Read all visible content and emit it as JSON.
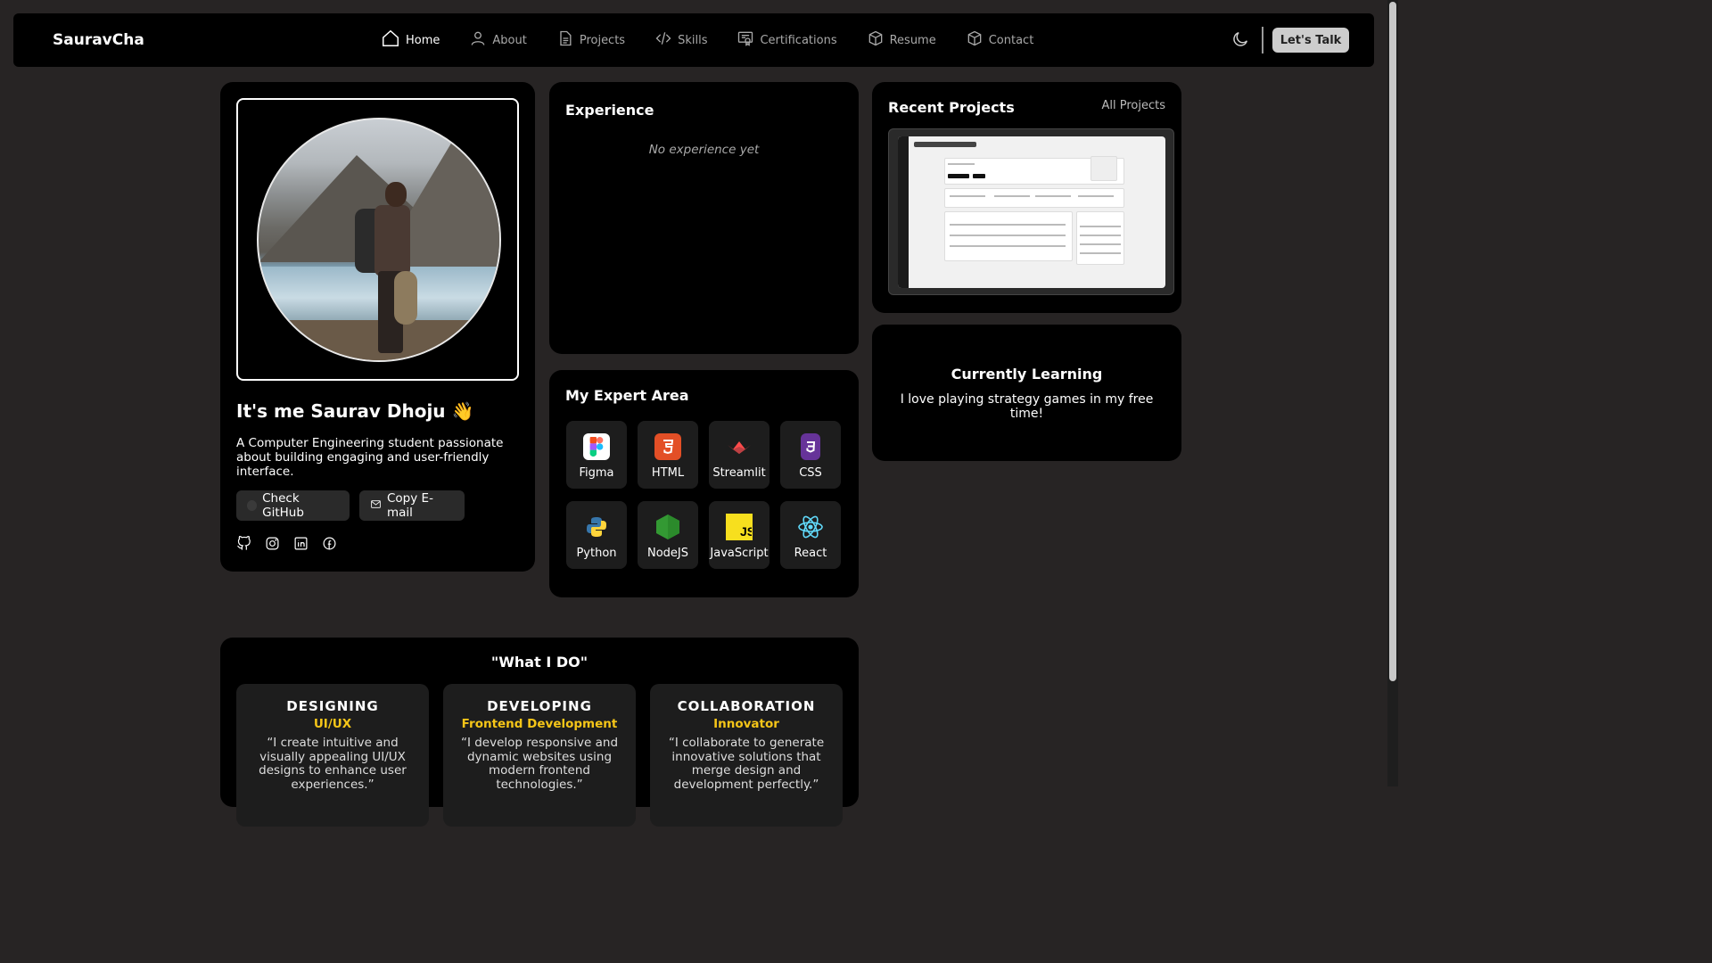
{
  "navbar": {
    "brand": "SauravCha",
    "items": [
      {
        "label": "Home",
        "icon": "home-icon",
        "active": true
      },
      {
        "label": "About",
        "icon": "user-icon"
      },
      {
        "label": "Projects",
        "icon": "file-icon"
      },
      {
        "label": "Skills",
        "icon": "code-icon"
      },
      {
        "label": "Certifications",
        "icon": "certificate-icon"
      },
      {
        "label": "Resume",
        "icon": "box-icon"
      },
      {
        "label": "Contact",
        "icon": "box-icon"
      }
    ],
    "theme_icon": "moon-icon",
    "cta_label": "Let's Talk"
  },
  "profile": {
    "greeting": "It's me Saurav Dhoju 👋",
    "bio": "A Computer Engineering student passionate about building engaging and user-friendly interface.",
    "github_label": "Check GitHub",
    "email_label": "Copy E-mail",
    "socials": [
      "github-icon",
      "instagram-icon",
      "linkedin-icon",
      "facebook-icon"
    ]
  },
  "experience": {
    "title": "Experience",
    "empty_text": "No experience yet"
  },
  "expert": {
    "title": "My Expert Area",
    "skills": [
      {
        "label": "Figma",
        "icon": "figma-icon",
        "color": "#ffffff"
      },
      {
        "label": "HTML",
        "icon": "html5-icon",
        "color": "#e34f26"
      },
      {
        "label": "Streamlit",
        "icon": "streamlit-icon",
        "color": "#ff4b4b"
      },
      {
        "label": "CSS",
        "icon": "css3-icon",
        "color": "#663399"
      },
      {
        "label": "Python",
        "icon": "python-icon",
        "color": "#3776ab"
      },
      {
        "label": "NodeJS",
        "icon": "nodejs-icon",
        "color": "#339933"
      },
      {
        "label": "JavaScript",
        "icon": "javascript-icon",
        "color": "#f7df1e"
      },
      {
        "label": "React",
        "icon": "react-icon",
        "color": "#61dafb"
      }
    ]
  },
  "projects": {
    "title": "Recent Projects",
    "all_label": "All Projects"
  },
  "learning": {
    "title": "Currently Learning",
    "text": "I love playing strategy games in my free time!"
  },
  "whatido": {
    "title": "\"What I DO\"",
    "cards": [
      {
        "heading": "DESIGNING",
        "sub": "UI/UX",
        "quote": "“I create intuitive and visually appealing UI/UX designs to enhance user experiences.”"
      },
      {
        "heading": "DEVELOPING",
        "sub": "Frontend Development",
        "quote": "“I develop responsive and dynamic websites using modern frontend technologies.”"
      },
      {
        "heading": "COLLABORATION",
        "sub": "Innovator",
        "quote": "“I collaborate to generate innovative solutions that merge design and development perfectly.”"
      }
    ]
  },
  "colors": {
    "background": "#272424",
    "card": "#000000",
    "accent": "#f5c518"
  }
}
